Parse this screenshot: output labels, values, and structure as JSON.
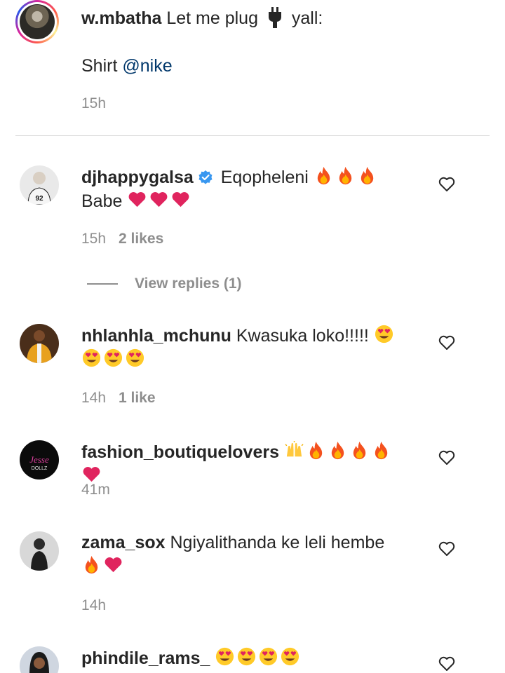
{
  "caption": {
    "username": "w.mbatha",
    "text_before_icon": "Let me plug",
    "text_after_icon": "yall:",
    "second_line_prefix": "Shirt",
    "mention": "@nike",
    "time": "15h",
    "icon": "electric-plug-icon"
  },
  "comments": [
    {
      "username": "djhappygalsa",
      "verified": true,
      "text": "Eqopheleni",
      "emojis_inline": [
        "fire",
        "fire",
        "fire"
      ],
      "line2_text": "Babe",
      "emojis_line2": [
        "heart",
        "heart",
        "heart"
      ],
      "time": "15h",
      "likes": "2 likes",
      "view_replies": "View replies (1)"
    },
    {
      "username": "nhlanhla_mchunu",
      "text": "Kwasuka loko!!!!!",
      "emojis_inline": [
        "heart-eyes"
      ],
      "emojis_line2": [
        "heart-eyes",
        "heart-eyes",
        "heart-eyes"
      ],
      "time": "14h",
      "likes": "1 like"
    },
    {
      "username": "fashion_boutiquelovers",
      "emojis_inline": [
        "raising-hands",
        "fire",
        "fire",
        "fire",
        "fire",
        "heart"
      ],
      "time": "41m"
    },
    {
      "username": "zama_sox",
      "text": "Ngiyalithanda ke leli hembe",
      "emojis_line2": [
        "fire",
        "heart"
      ],
      "time": "14h"
    },
    {
      "username": "phindile_rams_",
      "emojis_inline": [
        "heart-eyes",
        "heart-eyes",
        "heart-eyes",
        "heart-eyes"
      ]
    }
  ],
  "colors": {
    "text": "#262626",
    "secondary": "#8e8e8e",
    "mention": "#00376b",
    "verified": "#3897f0",
    "heart_emoji": "#e0245e",
    "divider": "#dbdbdb"
  }
}
